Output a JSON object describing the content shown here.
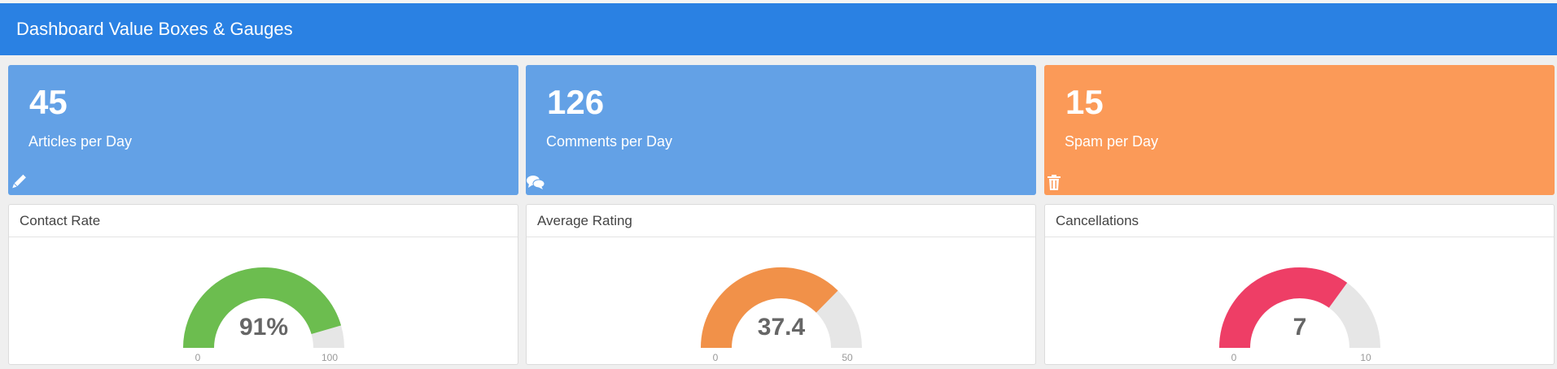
{
  "header": {
    "title": "Dashboard Value Boxes & Gauges"
  },
  "value_boxes": [
    {
      "value": "45",
      "label": "Articles per Day",
      "icon": "pencil-icon",
      "color": "#63a1e6"
    },
    {
      "value": "126",
      "label": "Comments per Day",
      "icon": "comments-icon",
      "color": "#63a1e6"
    },
    {
      "value": "15",
      "label": "Spam per Day",
      "icon": "trash-icon",
      "color": "#fb9a58"
    }
  ],
  "gauges": [
    {
      "title": "Contact Rate",
      "value": 91,
      "display": "91%",
      "min": 0,
      "max": 100,
      "min_label": "0",
      "max_label": "100",
      "color": "#6cbd4f"
    },
    {
      "title": "Average Rating",
      "value": 37.4,
      "display": "37.4",
      "min": 0,
      "max": 50,
      "min_label": "0",
      "max_label": "50",
      "color": "#f19149"
    },
    {
      "title": "Cancellations",
      "value": 7,
      "display": "7",
      "min": 0,
      "max": 10,
      "min_label": "0",
      "max_label": "10",
      "color": "#ee3e66"
    }
  ],
  "colors": {
    "header": "#2a81e3",
    "gauge_track": "#e6e6e6"
  }
}
